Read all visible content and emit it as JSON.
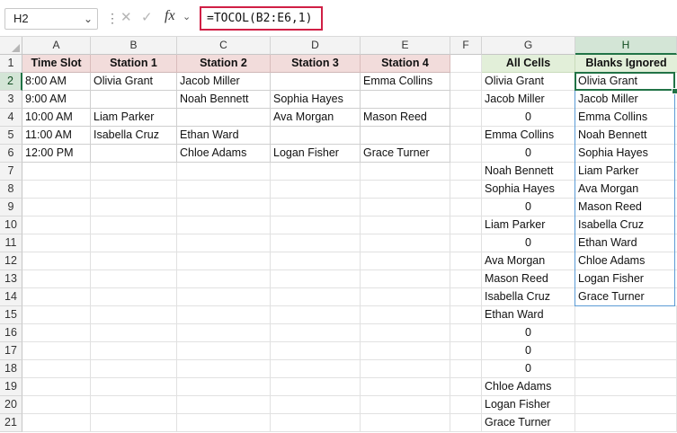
{
  "formula_bar": {
    "name_box": "H2",
    "formula": "=TOCOL(B2:E6,1)",
    "cancel_symbol": "✕",
    "enter_symbol": "✓",
    "fx_label": "fx"
  },
  "columns": [
    "A",
    "B",
    "C",
    "D",
    "E",
    "F",
    "G",
    "H"
  ],
  "selected_column": "H",
  "rows": [
    "1",
    "2",
    "3",
    "4",
    "5",
    "6",
    "7",
    "8",
    "9",
    "10",
    "11",
    "12",
    "13",
    "14",
    "15",
    "16",
    "17",
    "18",
    "19",
    "20",
    "21"
  ],
  "selected_row": "2",
  "schedule": {
    "headers": [
      "Time Slot",
      "Station 1",
      "Station 2",
      "Station 3",
      "Station 4"
    ],
    "rows": [
      [
        "8:00 AM",
        "Olivia Grant",
        "Jacob Miller",
        "",
        "Emma Collins"
      ],
      [
        "9:00 AM",
        "",
        "Noah Bennett",
        "Sophia Hayes",
        ""
      ],
      [
        "10:00 AM",
        "Liam Parker",
        "",
        "Ava Morgan",
        "Mason Reed"
      ],
      [
        "11:00 AM",
        "Isabella Cruz",
        "Ethan Ward",
        "",
        ""
      ],
      [
        "12:00 PM",
        "",
        "Chloe Adams",
        "Logan Fisher",
        "Grace Turner"
      ]
    ]
  },
  "all_cells": {
    "header": "All Cells",
    "values": [
      "Olivia Grant",
      "Jacob Miller",
      "0",
      "Emma Collins",
      "0",
      "Noah Bennett",
      "Sophia Hayes",
      "0",
      "Liam Parker",
      "0",
      "Ava Morgan",
      "Mason Reed",
      "Isabella Cruz",
      "Ethan Ward",
      "0",
      "0",
      "0",
      "Chloe Adams",
      "Logan Fisher",
      "Grace Turner"
    ]
  },
  "blanks_ignored": {
    "header": "Blanks Ignored",
    "values": [
      "Olivia Grant",
      "Jacob Miller",
      "Emma Collins",
      "Noah Bennett",
      "Sophia Hayes",
      "Liam Parker",
      "Ava Morgan",
      "Mason Reed",
      "Isabella Cruz",
      "Ethan Ward",
      "Chloe Adams",
      "Logan Fisher",
      "Grace Turner"
    ]
  },
  "colors": {
    "header_pink": "#f2dcdb",
    "header_green": "#e2efd9",
    "selection": "#217346",
    "spill_border": "#5b9bd5",
    "formula_highlight": "#d01f45"
  }
}
